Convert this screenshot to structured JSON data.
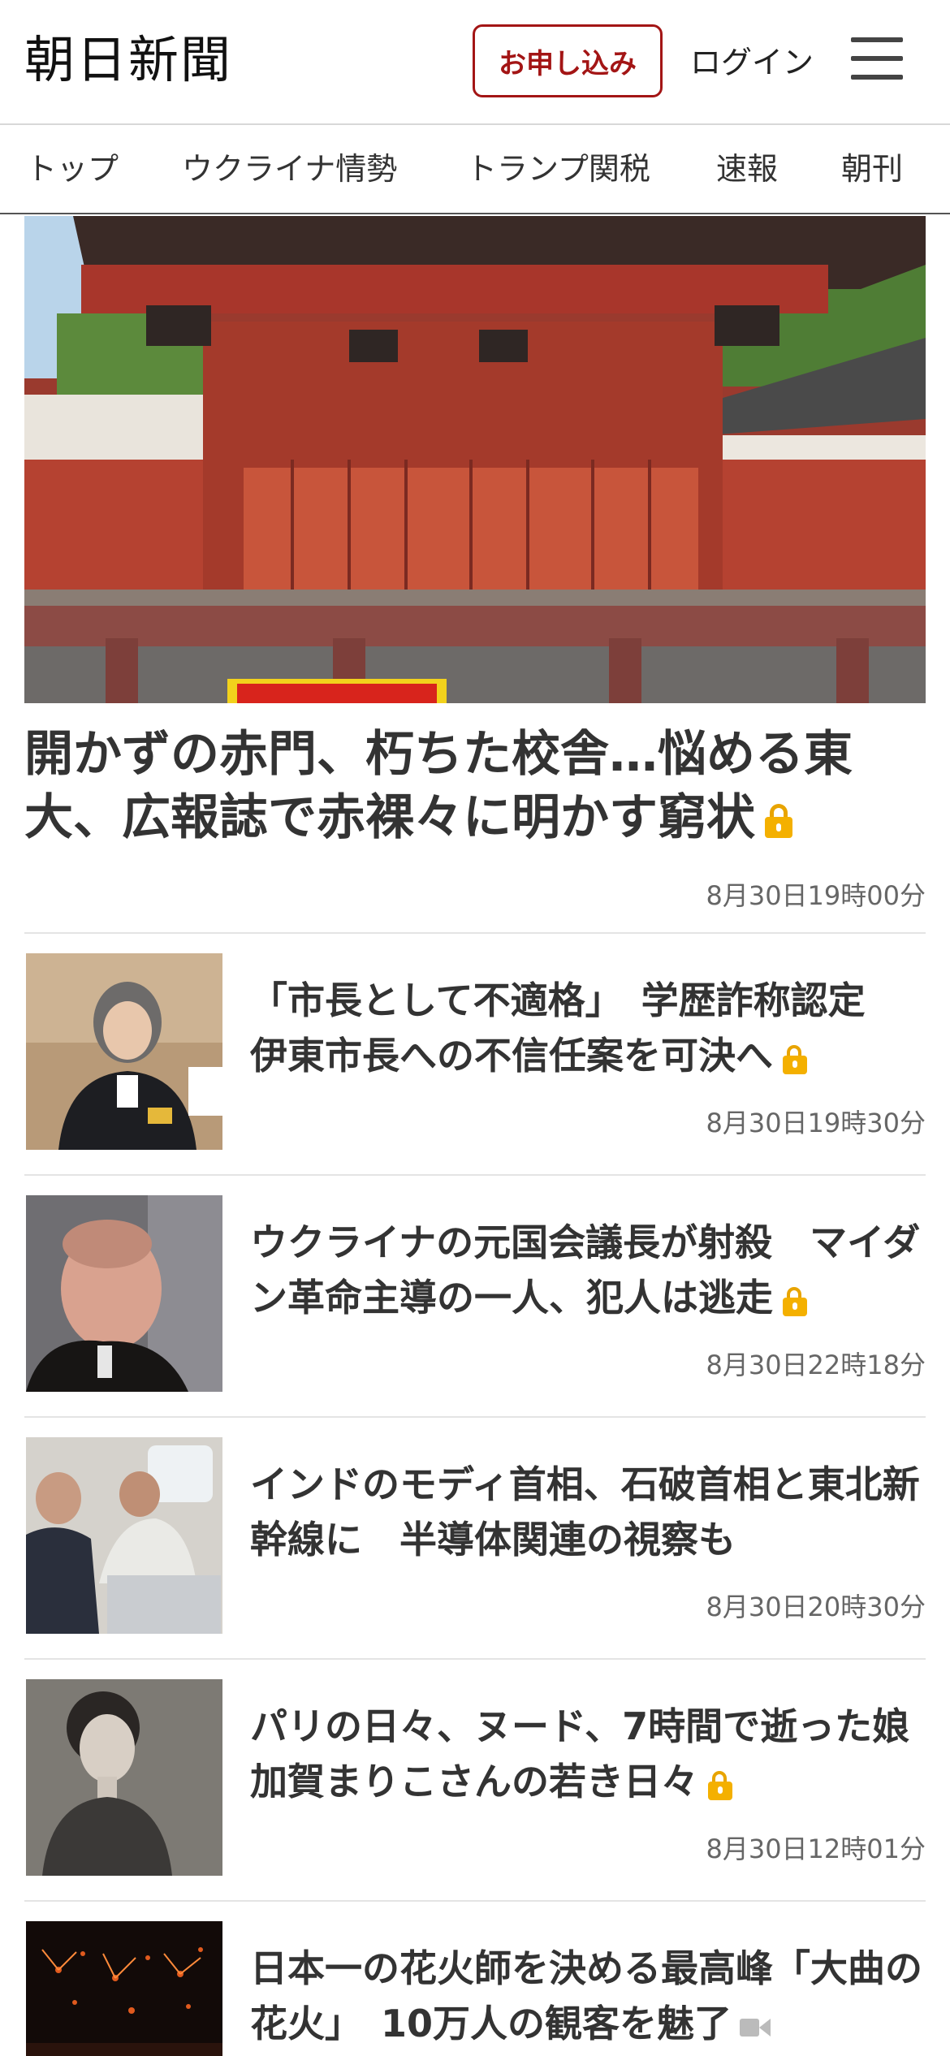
{
  "header": {
    "logo": "朝日新聞",
    "subscribe_label": "お申し込み",
    "login_label": "ログイン",
    "menu_icon": "hamburger-menu-icon"
  },
  "nav": {
    "tabs": [
      {
        "label": "トップ"
      },
      {
        "label": "ウクライナ情勢"
      },
      {
        "label": "トランプ関税"
      },
      {
        "label": "速報"
      },
      {
        "label": "朝刊"
      }
    ]
  },
  "hero": {
    "title": "開かずの赤門、朽ちた校舎…悩める東大、広報誌で赤裸々に明かす窮状",
    "time": "8月30日19時00分",
    "locked": true
  },
  "articles": [
    {
      "title": "「市長として不適格」　学歴詐称認定　伊東市長への不信任案を可決へ",
      "time": "8月30日19時30分",
      "badge": "lock-icon"
    },
    {
      "title": "ウクライナの元国会議長が射殺　マイダン革命主導の一人、犯人は逃走",
      "time": "8月30日22時18分",
      "badge": "lock-icon"
    },
    {
      "title": "インドのモディ首相、石破首相と東北新幹線に　半導体関連の視察も",
      "time": "8月30日20時30分",
      "badge": ""
    },
    {
      "title": "パリの日々、ヌード、7時間で逝った娘　加賀まりこさんの若き日々",
      "time": "8月30日12時01分",
      "badge": "lock-icon"
    },
    {
      "title": "日本一の花火師を決める最高峰「大曲の花火」　10万人の観客を魅了",
      "time": "",
      "badge": "video-icon"
    }
  ],
  "colors": {
    "brand_red": "#a31515",
    "lock_gold": "#f4b000",
    "text": "#333333",
    "meta": "#666666"
  }
}
